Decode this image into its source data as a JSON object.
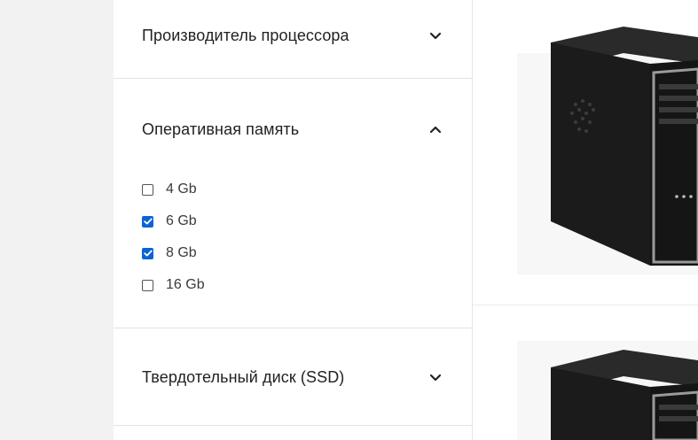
{
  "filters": {
    "cpu_maker": {
      "title": "Производитель процессора",
      "expanded": false,
      "chevron_icon": "chevron-down-icon"
    },
    "ram": {
      "title": "Оперативная память",
      "expanded": true,
      "chevron_icon": "chevron-up-icon",
      "options": [
        {
          "label": "4 Gb",
          "checked": false
        },
        {
          "label": "6 Gb",
          "checked": true
        },
        {
          "label": "8 Gb",
          "checked": true
        },
        {
          "label": "16 Gb",
          "checked": false
        }
      ]
    },
    "ssd": {
      "title": "Твердотельный диск (SSD)",
      "expanded": false,
      "chevron_icon": "chevron-down-icon"
    }
  },
  "products": [
    {
      "image": "pc-tower-image"
    },
    {
      "image": "pc-tower-image"
    }
  ],
  "colors": {
    "checkbox_checked": "#0b63d6",
    "left_gutter": "#f2f2f2",
    "divider": "#e3e3e3",
    "title_text": "#222222"
  }
}
